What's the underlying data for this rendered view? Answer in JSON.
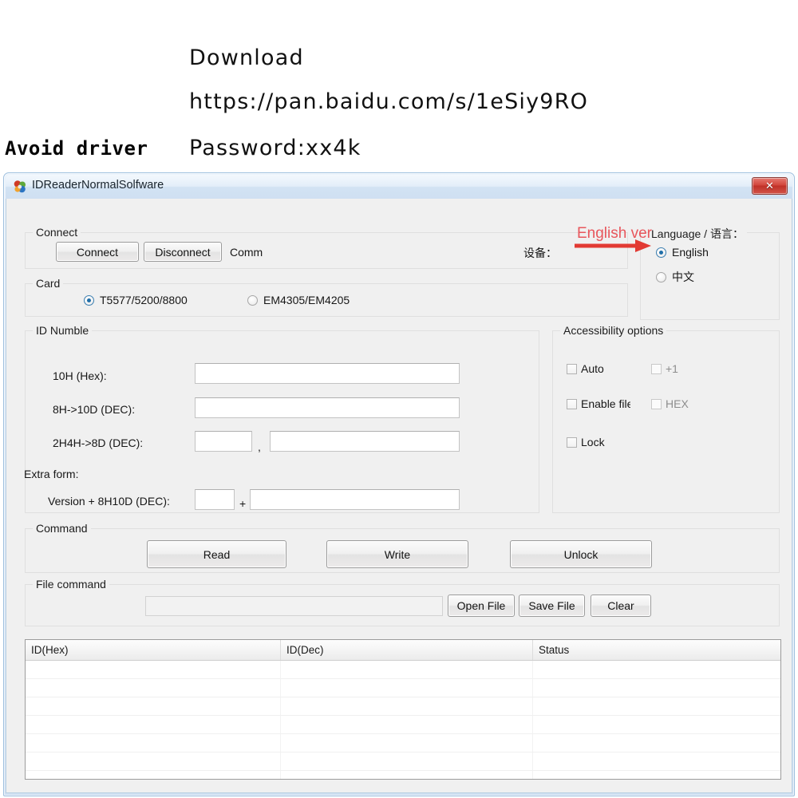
{
  "annotations": {
    "download_label": "Download",
    "url": "https://pan.baidu.com/s/1eSiy9RO",
    "password": "Password:xx4k",
    "avoid_driver": "Avoid driver",
    "english_ver": "English ver"
  },
  "window": {
    "title": "IDReaderNormalSolfware",
    "icon": "app-icon",
    "close_label": "✕"
  },
  "connect": {
    "group_title": "Connect",
    "connect_button": "Connect",
    "disconnect_button": "Disconnect",
    "comm_label": "Comm",
    "device_label": "设备："
  },
  "language": {
    "group_title": "Language / 语言：",
    "options": [
      {
        "label": "English",
        "selected": true
      },
      {
        "label": "中文",
        "selected": false
      }
    ]
  },
  "card": {
    "group_title": "Card",
    "options": [
      {
        "label": "T5577/5200/8800",
        "selected": true
      },
      {
        "label": "EM4305/EM4205",
        "selected": false
      }
    ]
  },
  "id_numble": {
    "group_title": "ID Numble",
    "rows": [
      {
        "label": "10H (Hex):",
        "value": ""
      },
      {
        "label": "8H->10D (DEC):",
        "value": ""
      },
      {
        "label": "2H4H->8D (DEC):",
        "value": "",
        "value2": "",
        "separator": ","
      }
    ],
    "extra_form_label": "Extra form:",
    "extra_row": {
      "label": "Version + 8H10D (DEC):",
      "value": "",
      "separator": "+",
      "value2": ""
    }
  },
  "accessibility": {
    "group_title": "Accessibility options",
    "items": [
      {
        "label": "Auto",
        "checked": false,
        "enabled": true
      },
      {
        "label": "+1",
        "checked": false,
        "enabled": false
      },
      {
        "label": "Enable file",
        "checked": false,
        "enabled": true
      },
      {
        "label": "HEX",
        "checked": false,
        "enabled": false
      },
      {
        "label": "Lock",
        "checked": false,
        "enabled": true
      }
    ]
  },
  "command": {
    "group_title": "Command",
    "read": "Read",
    "write": "Write",
    "unlock": "Unlock"
  },
  "file_command": {
    "group_title": "File command",
    "path_value": "",
    "open_file": "Open File",
    "save_file": "Save File",
    "clear": "Clear"
  },
  "list": {
    "columns": [
      "ID(Hex)",
      "ID(Dec)",
      "Status"
    ],
    "rows": []
  },
  "colors": {
    "accent_red": "#e8565c",
    "radio_blue": "#1f6ea8",
    "window_border": "#9fc0de"
  }
}
